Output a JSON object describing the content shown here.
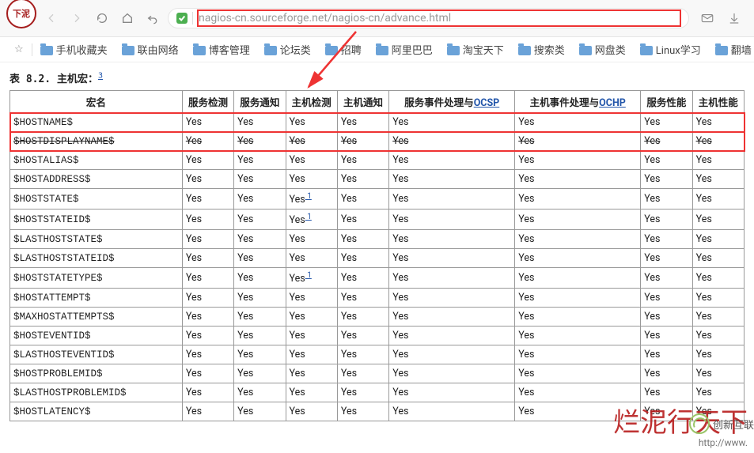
{
  "browser": {
    "logo_text": "下泥",
    "url": "nagios-cn.sourceforge.net/nagios-cn/advance.html",
    "bookmarks_first": "☆",
    "bookmarks": [
      "手机收藏夹",
      "联由网络",
      "博客管理",
      "论坛类",
      "招聘",
      "阿里巴巴",
      "淘宝天下",
      "搜索类",
      "网盘类",
      "Linux学习",
      "翻墙"
    ]
  },
  "page": {
    "caption_prefix": "表 8.2. 主机宏：",
    "caption_fn": "3",
    "headers": {
      "name": "宏名",
      "svc_check": "服务检测",
      "svc_notify": "服务通知",
      "host_check": "主机检测",
      "host_notify": "主机通知",
      "svc_event_prefix": "服务事件处理与",
      "svc_event_link": "OCSP",
      "host_event_prefix": "主机事件处理与",
      "host_event_link": "OCHP",
      "svc_perf": "服务性能",
      "host_perf": "主机性能"
    },
    "rows": [
      {
        "name": "$HOSTNAME$",
        "v": [
          "Yes",
          "Yes",
          "Yes",
          "Yes",
          "Yes",
          "Yes",
          "Yes",
          "Yes"
        ],
        "hi": true
      },
      {
        "name": "$HOSTDISPLAYNAME$",
        "v": [
          "Yes",
          "Yes",
          "Yes",
          "Yes",
          "Yes",
          "Yes",
          "Yes",
          "Yes"
        ],
        "hi": true,
        "strike": true
      },
      {
        "name": "$HOSTALIAS$",
        "v": [
          "Yes",
          "Yes",
          "Yes",
          "Yes",
          "Yes",
          "Yes",
          "Yes",
          "Yes"
        ]
      },
      {
        "name": "$HOSTADDRESS$",
        "v": [
          "Yes",
          "Yes",
          "Yes",
          "Yes",
          "Yes",
          "Yes",
          "Yes",
          "Yes"
        ]
      },
      {
        "name": "$HOSTSTATE$",
        "v": [
          "Yes",
          "Yes",
          "Yes",
          "Yes",
          "Yes",
          "Yes",
          "Yes",
          "Yes"
        ],
        "fn": [
          null,
          null,
          "1",
          null,
          null,
          null,
          null,
          null
        ]
      },
      {
        "name": "$HOSTSTATEID$",
        "v": [
          "Yes",
          "Yes",
          "Yes",
          "Yes",
          "Yes",
          "Yes",
          "Yes",
          "Yes"
        ],
        "fn": [
          null,
          null,
          "1",
          null,
          null,
          null,
          null,
          null
        ]
      },
      {
        "name": "$LASTHOSTSTATE$",
        "v": [
          "Yes",
          "Yes",
          "Yes",
          "Yes",
          "Yes",
          "Yes",
          "Yes",
          "Yes"
        ]
      },
      {
        "name": "$LASTHOSTSTATEID$",
        "v": [
          "Yes",
          "Yes",
          "Yes",
          "Yes",
          "Yes",
          "Yes",
          "Yes",
          "Yes"
        ]
      },
      {
        "name": "$HOSTSTATETYPE$",
        "v": [
          "Yes",
          "Yes",
          "Yes",
          "Yes",
          "Yes",
          "Yes",
          "Yes",
          "Yes"
        ],
        "fn": [
          null,
          null,
          "1",
          null,
          null,
          null,
          null,
          null
        ]
      },
      {
        "name": "$HOSTATTEMPT$",
        "v": [
          "Yes",
          "Yes",
          "Yes",
          "Yes",
          "Yes",
          "Yes",
          "Yes",
          "Yes"
        ]
      },
      {
        "name": "$MAXHOSTATTEMPTS$",
        "v": [
          "Yes",
          "Yes",
          "Yes",
          "Yes",
          "Yes",
          "Yes",
          "Yes",
          "Yes"
        ]
      },
      {
        "name": "$HOSTEVENTID$",
        "v": [
          "Yes",
          "Yes",
          "Yes",
          "Yes",
          "Yes",
          "Yes",
          "Yes",
          "Yes"
        ]
      },
      {
        "name": "$LASTHOSTEVENTID$",
        "v": [
          "Yes",
          "Yes",
          "Yes",
          "Yes",
          "Yes",
          "Yes",
          "Yes",
          "Yes"
        ]
      },
      {
        "name": "$HOSTPROBLEMID$",
        "v": [
          "Yes",
          "Yes",
          "Yes",
          "Yes",
          "Yes",
          "Yes",
          "Yes",
          "Yes"
        ]
      },
      {
        "name": "$LASTHOSTPROBLEMID$",
        "v": [
          "Yes",
          "Yes",
          "Yes",
          "Yes",
          "Yes",
          "Yes",
          "Yes",
          "Yes"
        ]
      },
      {
        "name": "$HOSTLATENCY$",
        "v": [
          "Yes",
          "Yes",
          "Yes",
          "Yes",
          "Yes",
          "Yes",
          "Yes",
          "Yes"
        ]
      }
    ]
  },
  "watermark": {
    "big": "烂泥行天下",
    "small": "http://www.",
    "logo_label": "创新互联"
  }
}
